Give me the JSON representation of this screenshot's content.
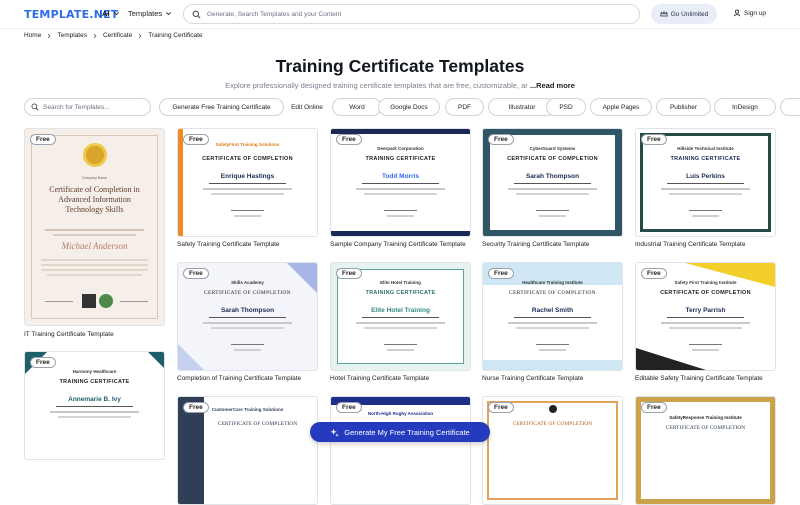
{
  "brand": {
    "logo": "TEMPLATE.NET"
  },
  "nav": {
    "ai_label": "AI",
    "templates_label": "Templates",
    "search_placeholder": "Generate, Search Templates and your Content",
    "unlimited_label": "Go Unlimited",
    "signup_label": "Sign up"
  },
  "breadcrumb": [
    "Home",
    "Templates",
    "Certificate",
    "Training Certificate"
  ],
  "hero": {
    "title": "Training Certificate Templates",
    "subtitle": "Explore professionally designed training certificate templates that are free, customizable, ar",
    "read_more": "...Read more"
  },
  "filters": {
    "search_placeholder": "Search for Templates...",
    "chips": [
      "Generate Free Training Certificate",
      "Edit Online",
      "Word",
      "Google Docs",
      "PDF",
      "Illustrator",
      "PSD",
      "Apple Pages",
      "Publisher",
      "InDesign"
    ]
  },
  "free_badge": "Free",
  "cards": [
    {
      "label": "IT Training Certificate Template",
      "institution": "Company Name",
      "cert_title": "Certificate of Completion in Advanced Information Technology Skills",
      "recipient": "Michael Anderson"
    },
    {
      "label": "Safety Training Certificate Template",
      "institution": "SafetyFirst Training Solutions",
      "cert_title": "CERTIFICATE OF COMPLETION",
      "recipient": "Enrique Hastings"
    },
    {
      "label": "Sample Company Training Certificate Template",
      "institution": "Deerpark Corporation",
      "cert_title": "TRAINING CERTIFICATE",
      "recipient": "Todd Morris"
    },
    {
      "label": "Security Training Certificate Template",
      "institution": "CyberGuard Systems",
      "cert_title": "CERTIFICATE OF COMPLETION",
      "recipient": "Sarah Thompson"
    },
    {
      "label": "Industrial Training Certificate Template",
      "institution": "Hillside Technical Institute",
      "cert_title": "TRAINING CERTIFICATE",
      "recipient": "Luis Perkins"
    },
    {
      "label": "Completion of Training Certificate Template",
      "institution": "Skills Academy",
      "cert_title": "CERTIFICATE OF COMPLETION",
      "recipient": "Sarah Thompson"
    },
    {
      "label": "Hotel Training Certificate Template",
      "institution": "Elite Hotel Training",
      "cert_title": "TRAINING CERTIFICATE",
      "recipient": "Elite Hotel Training"
    },
    {
      "label": "Nurse Training Certificate Template",
      "institution": "Healthcare Training Institute",
      "cert_title": "CERTIFICATE OF COMPLETION",
      "recipient": "Rachel Smith"
    },
    {
      "label": "Editable Safety Training Certificate Template",
      "institution": "Safety First Training Institute",
      "cert_title": "CERTIFICATE OF COMPLETION",
      "recipient": "Terry Parrish"
    },
    {
      "institution": "Harmony Healthcare",
      "cert_title": "TRAINING CERTIFICATE",
      "recipient": "Annemarie B. Ivy"
    },
    {
      "institution": "CustomerCare Training Solutions",
      "cert_title": "CERTIFICATE OF COMPLETION"
    },
    {
      "institution": "North-High Rugby Association"
    },
    {
      "cert_title": "CERTIFICATE OF COMPLETION"
    },
    {
      "institution": "SafetyResponse Training Institute",
      "cert_title": "CERTIFICATE OF COMPLETION"
    }
  ],
  "generate_button": "Generate My Free Training Certificate",
  "colors": {
    "accent": "#243bbd",
    "logo": "#2d6be8"
  }
}
